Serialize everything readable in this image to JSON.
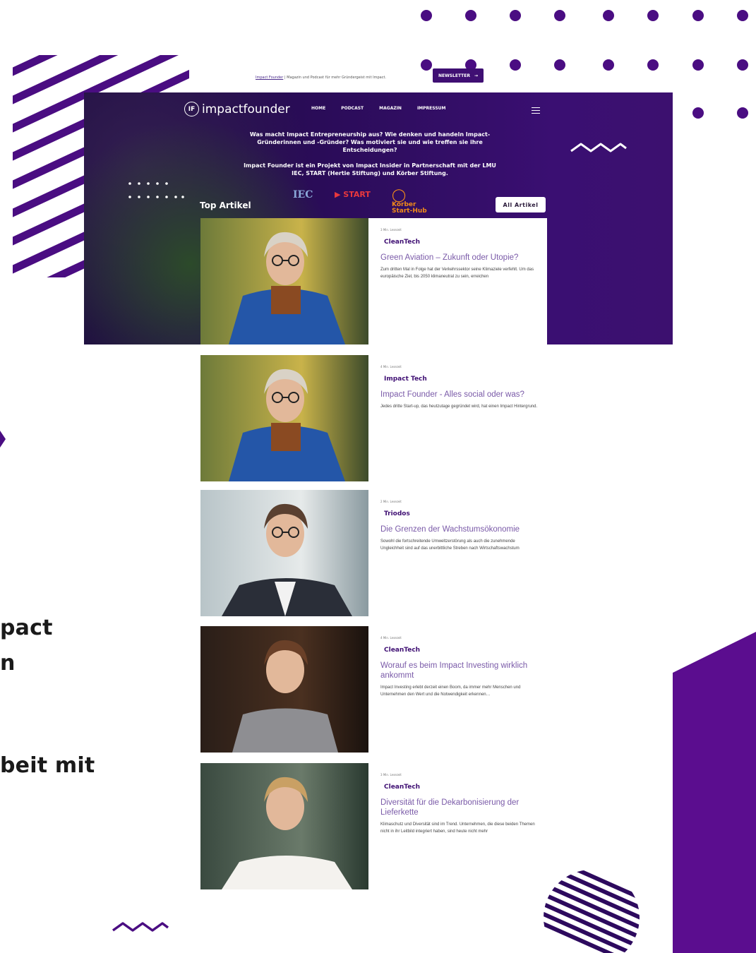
{
  "topbar": {
    "link_label": "Impact Founder",
    "tagline": "| Magazin und Podcast für mehr Gründergeist mit Impact.",
    "newsletter_label": "NEWSLETTER"
  },
  "hero": {
    "logo_badge": "IF",
    "logo_text": "impactfounder",
    "nav": [
      "HOME",
      "PODCAST",
      "MAGAZIN",
      "IMPRESSUM"
    ],
    "intro_lines": [
      "Was macht Impact Entrepreneurship aus? Wie denken und handeln Impact-",
      "Gründerinnen und -Gründer? Was motiviert sie und wie treffen sie ihre",
      "Entscheidungen?"
    ],
    "partner_lines": [
      "Impact Founder ist ein Projekt von Impact Insider in Partnerschaft mit der LMU",
      "IEC, START (Hertie Stiftung) und Körber Stiftung."
    ],
    "section_title": "Top Artikel",
    "partners": {
      "iec": "IEC",
      "start": "START",
      "koerber_1": "Körber",
      "koerber_2": "Start-Hub"
    },
    "all_articles_label": "All Artikel"
  },
  "background_text": {
    "line1": "pact",
    "line2": "n",
    "line3": "beit mit"
  },
  "articles": [
    {
      "readtime": "3 Min. Lesezeit",
      "category": "CleanTech",
      "title": "Green Aviation – Zukunft oder Utopie?",
      "excerpt": "Zum dritten Mal in Folge hat der Verkehrssektor seine Klimaziele verfehlt. Um das europäische Ziel, bis 2050 klimaneutral zu sein, erreichen",
      "image": "man-glasses-blue-jacket"
    },
    {
      "readtime": "4 Min. Lesezeit",
      "category": "Impact Tech",
      "title": "Impact Founder - Alles social oder was?",
      "excerpt": "Jedes dritte Start-up, das heutzutage gegründet wird, hat einen Impact Hintergrund.",
      "image": "man-glasses-blue-jacket"
    },
    {
      "readtime": "2 Min. Lesezeit",
      "category": "Triodos",
      "title": "Die Grenzen der Wachstumsökonomie",
      "excerpt": "Sowohl die fortschreitende Umweltzerstörung als auch die zunehmende Ungleichheit sind auf das unerbittliche Streben nach Wirtschaftswachstum",
      "image": "man-smiling-suit"
    },
    {
      "readtime": "4 Min. Lesezeit",
      "category": "CleanTech",
      "title": "Worauf es beim Impact Investing wirklich ankommt",
      "excerpt": "Impact Investing erlebt derzeit einen Boom, da immer mehr Menschen und Unternehmen den Wert und die Notwendigkeit erkennen…",
      "image": "woman-grey-sweater"
    },
    {
      "readtime": "3 Min. Lesezeit",
      "category": "CleanTech",
      "title": "Diversität für die Dekarbonisierung der Lieferkette",
      "excerpt": "Klimaschutz und Diversität sind im Trend. Unternehmen, die diese beiden Themen nicht in ihr Leitbild integriert haben, sind heute nicht mehr",
      "image": "woman-blonde-smiling"
    }
  ],
  "colors": {
    "brand_purple": "#3f0f73",
    "accent_purple": "#5b0d8f",
    "title_purple": "#7a5aa8"
  }
}
